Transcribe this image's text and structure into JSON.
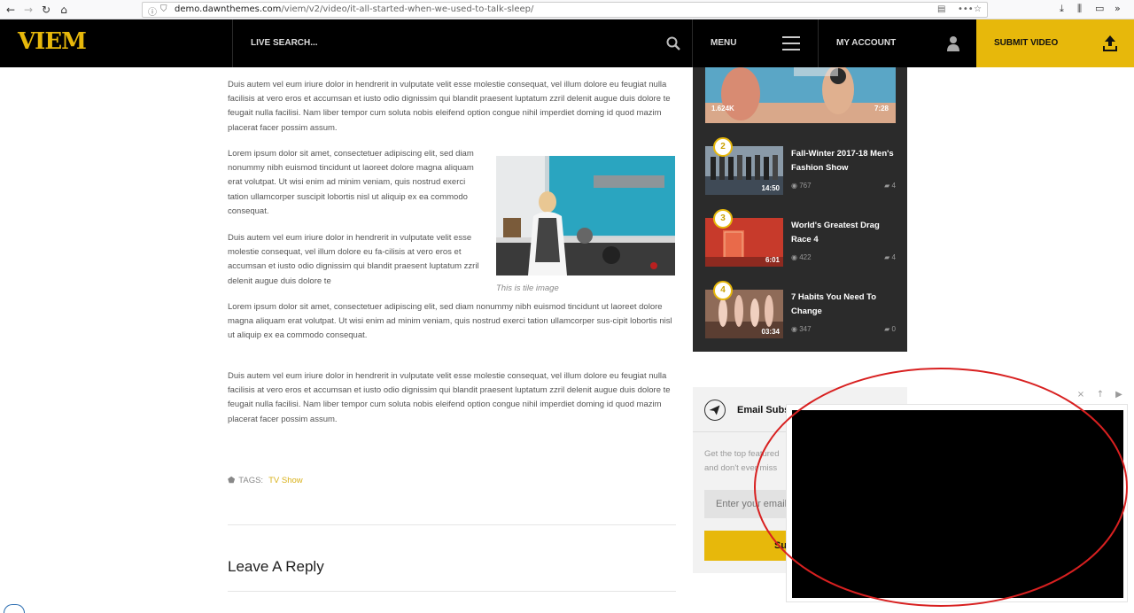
{
  "browser": {
    "url_host": "demo.dawnthemes.com",
    "url_path": "/viem/v2/video/it-all-started-when-we-used-to-talk-sleep/"
  },
  "header": {
    "logo": "VIEM",
    "search_label": "LIVE SEARCH...",
    "menu_label": "MENU",
    "account_label": "MY ACCOUNT",
    "submit_label": "SUBMIT VIDEO"
  },
  "article": {
    "paragraphs": [
      "Duis autem vel eum iriure dolor in hendrerit in vulputate velit esse molestie consequat, vel illum dolore eu feugiat nulla facilisis at vero eros et accumsan et iusto odio dignissim qui blandit praesent luptatum zzril delenit augue duis dolore te feugait nulla facilisi. Nam liber tempor cum soluta nobis eleifend option congue nihil imperdiet doming id quod mazim placerat facer possim assum.",
      "Lorem ipsum dolor sit amet, consectetuer adipiscing elit, sed diam nonummy nibh euismod tincidunt ut laoreet dolore magna aliquam erat volutpat. Ut wisi enim ad minim veniam, quis nostrud exerci tation ullamcorper suscipit lobortis nisl ut aliquip ex ea commodo consequat.",
      "Duis autem vel eum iriure dolor in hendrerit in vulputate velit esse molestie consequat, vel illum dolore eu fa-cilisis at vero eros et accumsan et iusto odio dignissim qui blandit praesent luptatum zzril delenit augue duis dolore te",
      "Lorem ipsum dolor sit amet, consectetuer adipiscing elit, sed diam nonummy nibh euismod tincidunt ut laoreet dolore magna aliquam erat volutpat. Ut wisi enim ad minim veniam, quis nostrud exerci tation ullamcorper sus-cipit lobortis nisl ut aliquip ex ea commodo consequat.",
      "Duis autem vel eum iriure dolor in hendrerit in vulputate velit esse molestie consequat, vel illum dolore eu feugiat nulla facilisis at vero eros et accumsan et iusto odio dignissim qui blandit praesent luptatum zzril delenit augue duis dolore te feugait nulla facilisi. Nam liber tempor cum soluta nobis eleifend option congue nihil imperdiet doming id quod mazim placerat facer possim assum."
    ],
    "image_caption": "This is tile image",
    "tags_label": "TAGS:",
    "tag": "TV Show",
    "reply_title": "Leave A Reply"
  },
  "sidebar": {
    "first_item": {
      "likes": "1.624K",
      "duration": "7:28"
    },
    "items": [
      {
        "rank": "2",
        "title": "Fall-Winter 2017-18 Men's Fashion Show",
        "duration": "14:50",
        "views": "767",
        "comments": "4"
      },
      {
        "rank": "3",
        "title": "World's Greatest Drag Race 4",
        "duration": "6:01",
        "views": "422",
        "comments": "4"
      },
      {
        "rank": "4",
        "title": "7 Habits You Need To Change",
        "duration": "03:34",
        "views": "347",
        "comments": "0"
      }
    ]
  },
  "email": {
    "title": "Email Subs",
    "desc_line1": "Get the top featured",
    "desc_line2": "and don't ever miss",
    "placeholder": "Enter your email",
    "submit_label": "Su"
  },
  "player": {
    "close": "×",
    "up": "↑",
    "play": "▶"
  },
  "colors": {
    "accent": "#e7b80b",
    "sidebar_bg": "#2b2b2b",
    "annotation_red": "#d82020"
  }
}
